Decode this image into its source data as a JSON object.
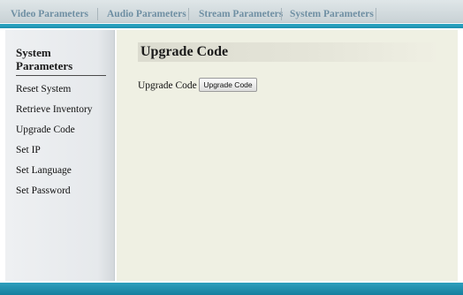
{
  "topnav": {
    "tabs": [
      {
        "label": "Video Parameters"
      },
      {
        "label": "Audio Parameters"
      },
      {
        "label": "Stream Parameters"
      },
      {
        "label": "System Parameters"
      }
    ]
  },
  "sidebar": {
    "heading": "System Parameters",
    "items": [
      {
        "label": "Reset System"
      },
      {
        "label": "Retrieve Inventory"
      },
      {
        "label": "Upgrade Code"
      },
      {
        "label": "Set IP"
      },
      {
        "label": "Set Language"
      },
      {
        "label": "Set Password"
      }
    ]
  },
  "main": {
    "title": "Upgrade Code",
    "field_label": "Upgrade Code :",
    "button_label": "Upgrade Code"
  }
}
